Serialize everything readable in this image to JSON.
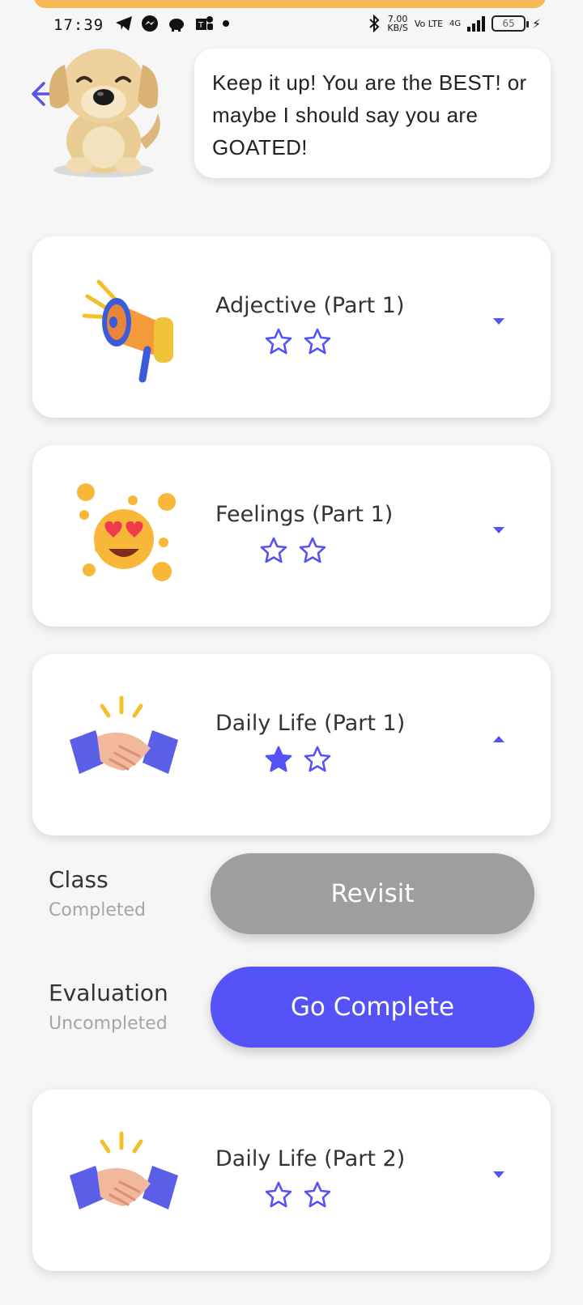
{
  "status_bar": {
    "time": "17:39",
    "net_speed_value": "7.00",
    "net_speed_unit": "KB/S",
    "volte": "Vo LTE",
    "network": "4G",
    "battery": "65"
  },
  "mascot": {
    "message": "Keep it up! You are the BEST! or maybe I should say you are GOATED!"
  },
  "lessons": [
    {
      "title": "Adjective (Part 1)",
      "icon": "megaphone-icon",
      "stars_filled": 0,
      "stars_total": 2,
      "expanded": false
    },
    {
      "title": "Feelings (Part 1)",
      "icon": "heart-eyes-emoji-icon",
      "stars_filled": 0,
      "stars_total": 2,
      "expanded": false
    },
    {
      "title": "Daily Life (Part 1)",
      "icon": "handshake-icon",
      "stars_filled": 1,
      "stars_total": 2,
      "expanded": true
    },
    {
      "title": "Daily Life (Part 2)",
      "icon": "handshake-icon",
      "stars_filled": 0,
      "stars_total": 2,
      "expanded": false
    }
  ],
  "details": {
    "class_label": "Class",
    "class_status": "Completed",
    "revisit_label": "Revisit",
    "evaluation_label": "Evaluation",
    "evaluation_status": "Uncompleted",
    "go_complete_label": "Go Complete"
  },
  "colors": {
    "accent": "#5552f7",
    "top_strip": "#f7b955",
    "revisit": "#9e9e9e"
  }
}
